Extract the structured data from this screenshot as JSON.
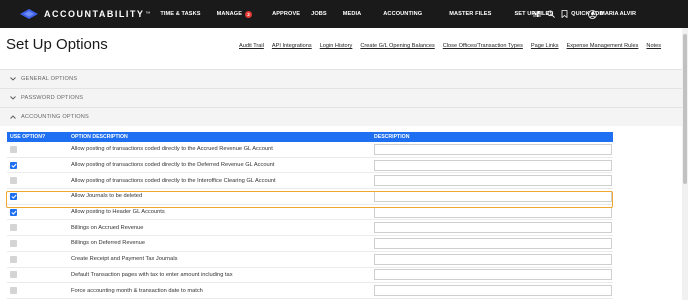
{
  "brand": {
    "name": "ACCOUNTABILITY",
    "tm": "™"
  },
  "nav": {
    "items": [
      {
        "label": "TIME & TASKS"
      },
      {
        "label": "MANAGE",
        "badge": "2"
      },
      {
        "label": "APPROVE"
      },
      {
        "label": "JOBS"
      },
      {
        "label": "MEDIA"
      },
      {
        "label": "ACCOUNTING"
      },
      {
        "label": "MASTER FILES"
      },
      {
        "label": "SET UP FILES"
      },
      {
        "label": "QUICK ADD"
      }
    ],
    "icons": [
      "sliders-icon",
      "search-icon",
      "bookmark-icon",
      "user-circle-icon"
    ],
    "user_name": "MARIA ALVIR"
  },
  "page": {
    "title": "Set Up Options",
    "links": [
      "Audit Trail",
      "API Integrations",
      "Login History",
      "Create G/L Opening Balances",
      "Close Offices/Transaction Types",
      "Page Links",
      "Expense Management Rules",
      "Notes"
    ]
  },
  "sections": {
    "general": "GENERAL OPTIONS",
    "password": "PASSWORD OPTIONS",
    "accounting": "ACCOUNTING OPTIONS"
  },
  "table": {
    "headers": {
      "use": "USE OPTION?",
      "option": "OPTION DESCRIPTION",
      "description": "DESCRIPTION"
    },
    "rows": [
      {
        "label": "Allow posting of transactions coded directly to the Accrued Revenue GL Account",
        "checked": false,
        "description": ""
      },
      {
        "label": "Allow posting of transactions coded directly to the Deferred Revenue GL Account",
        "checked": true,
        "description": ""
      },
      {
        "label": "Allow posting of transactions coded directly to the Interoffice Clearing GL Account",
        "checked": false,
        "description": ""
      },
      {
        "label": "Allow Journals to be deleted",
        "checked": true,
        "description": ""
      },
      {
        "label": "Allow posting to Header GL Accounts",
        "checked": true,
        "description": ""
      },
      {
        "label": "Billings on Accrued Revenue",
        "checked": false,
        "description": ""
      },
      {
        "label": "Billings on Deferred Revenue",
        "checked": false,
        "description": ""
      },
      {
        "label": "Create Receipt and Payment Tax Journals",
        "checked": false,
        "description": ""
      },
      {
        "label": "Default Transaction pages with tax to enter amount including tax",
        "checked": false,
        "description": ""
      },
      {
        "label": "Force accounting month & transaction date to match",
        "checked": false,
        "description": ""
      }
    ]
  },
  "colors": {
    "topbar": "#1a1a1a",
    "accent": "#1e6ff2",
    "highlight": "#f0a830",
    "badge": "#e53935"
  }
}
